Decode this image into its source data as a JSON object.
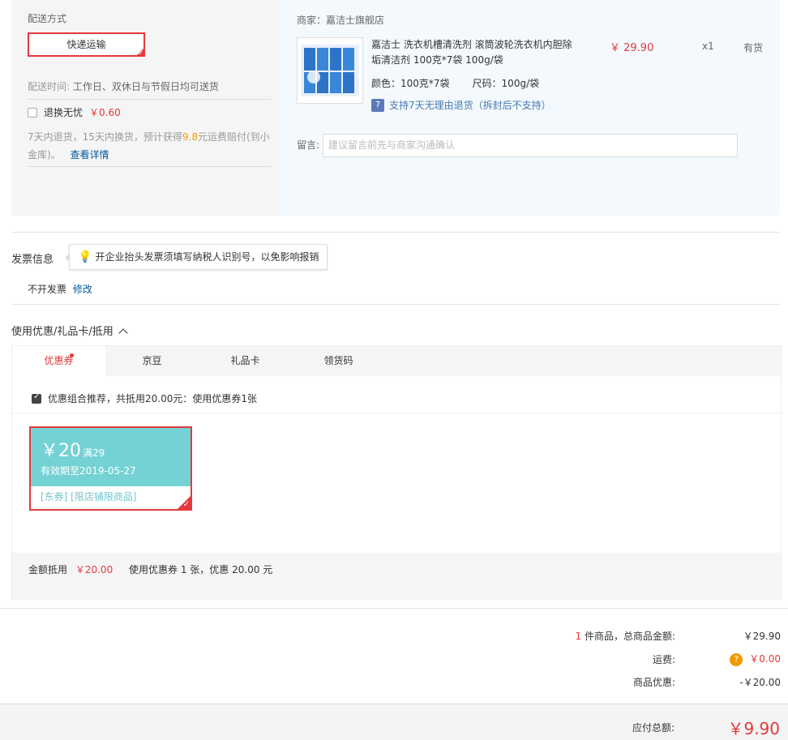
{
  "delivery": {
    "title": "配送方式",
    "ship_method": "快递运输",
    "time_label": "配送时间:",
    "time_value": "工作日、双休日与节假日均可送货",
    "return_label": "退换无忧",
    "return_price": "￥0.60",
    "return_desc_pre": "7天内退货，15天内换货，预计获得",
    "return_desc_amount": "9.8",
    "return_desc_post": "元运费赔付(到小金库)。",
    "return_link": "查看详情"
  },
  "product": {
    "merchant": "商家：嘉洁士旗舰店",
    "title": "嘉洁士 洗衣机槽清洗剂 滚筒波轮洗衣机内胆除垢清洁剂 100克*7袋 100g/袋",
    "price": "￥ 29.90",
    "qty": "x1",
    "stock": "有货",
    "color": "颜色：100克*7袋",
    "size": "尺码：100g/袋",
    "return_note": "支持7天无理由退货（拆封后不支持）",
    "return_icon_text": "7",
    "message_label": "留言:",
    "message_placeholder": "建议留言前先与商家沟通确认"
  },
  "invoice": {
    "title": "发票信息",
    "tip": "开企业抬头发票须填写纳税人识别号，以免影响报销",
    "value": "不开发票",
    "edit_link": "修改"
  },
  "coupons": {
    "title": "使用优惠/礼品卡/抵用",
    "tabs": [
      "优惠券",
      "京豆",
      "礼品卡",
      "领货码"
    ],
    "recommend": "优惠组合推荐，共抵用20.00元：使用优惠券1张",
    "coupon": {
      "amount": "￥20",
      "condition": "满29",
      "validity": "有效期至2019-05-27",
      "tags": "[东券]  [限店铺限商品]"
    },
    "footer_label": "金额抵用",
    "footer_amount": "￥20.00",
    "footer_text": "使用优惠券 1 张，优惠 20.00 元"
  },
  "summary": {
    "count": "1",
    "count_label": "件商品，总商品金额:",
    "goods_total": "￥29.90",
    "shipping_label": "运费:",
    "shipping_help": "?",
    "shipping_value": "￥0.00",
    "discount_label": "商品优惠:",
    "discount_value": "-￥20.00",
    "total_label": "应付总额:",
    "total_value": "￥9.90"
  },
  "colors": {
    "accent": "#e4393c",
    "link": "#005aa0",
    "coupon": "#74d2d4",
    "orange": "#f39800"
  }
}
